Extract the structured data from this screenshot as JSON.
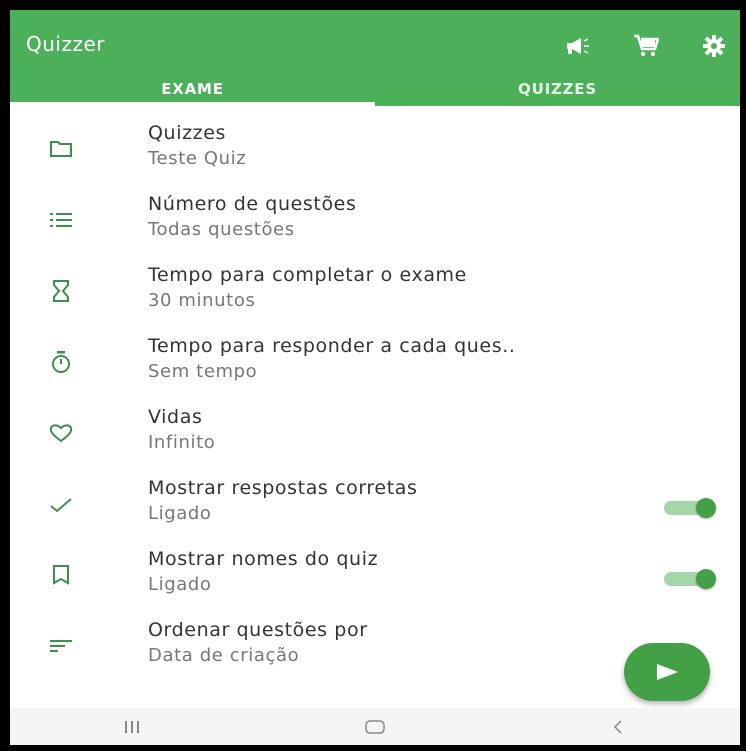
{
  "app": {
    "title": "Quizzer"
  },
  "toolbar": {
    "icons": [
      "megaphone-icon",
      "cart-icon",
      "gear-icon"
    ]
  },
  "tabs": [
    {
      "label": "EXAME",
      "active": true
    },
    {
      "label": "QUIZZES",
      "active": false
    }
  ],
  "settings": [
    {
      "icon": "folder-icon",
      "title": "Quizzes",
      "value": "Teste Quiz"
    },
    {
      "icon": "list-number-icon",
      "title": "Número de questões",
      "value": "Todas questões"
    },
    {
      "icon": "hourglass-icon",
      "title": "Tempo para completar o exame",
      "value": "30 minutos"
    },
    {
      "icon": "stopwatch-icon",
      "title": "Tempo para responder a cada ques..",
      "value": "Sem tempo"
    },
    {
      "icon": "heart-icon",
      "title": "Vidas",
      "value": "Infinito"
    },
    {
      "icon": "check-icon",
      "title": "Mostrar respostas corretas",
      "value": "Ligado",
      "toggle": true
    },
    {
      "icon": "label-icon",
      "title": "Mostrar nomes do quiz",
      "value": "Ligado",
      "toggle": true
    },
    {
      "icon": "sort-icon",
      "title": "Ordenar questões por",
      "value": "Data de criação"
    }
  ],
  "fab": {
    "icon": "play-icon"
  },
  "nav": [
    "recents-icon",
    "home-icon",
    "back-icon"
  ],
  "colors": {
    "primary": "#4caf5a",
    "accent": "#43a047",
    "text": "#333333",
    "secondary_text": "#777777"
  }
}
